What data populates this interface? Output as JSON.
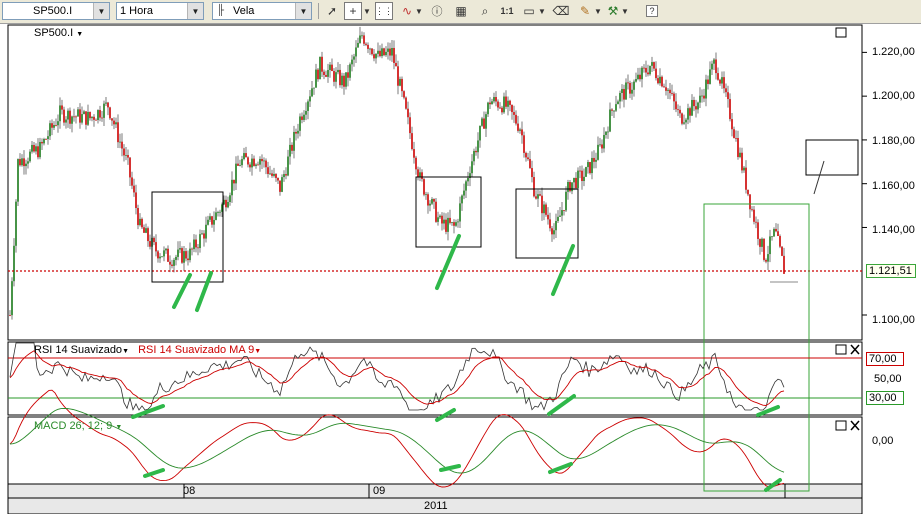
{
  "toolbar": {
    "symbol": "SP500.I",
    "timeframe": "1 Hora",
    "chart_type": "Vela",
    "icons": [
      "cursor-icon",
      "crosshair-icon",
      "dropdown-arrow-icon",
      "grid-dots-icon",
      "indicator-wave-icon",
      "info-icon",
      "chart-options-icon",
      "zoom-icon",
      "one-to-one-icon",
      "rectangle-icon",
      "eraser-icon",
      "paint-icon",
      "tools-icon",
      "help-icon"
    ],
    "one_to_one_label": "1:1",
    "help_label": "?"
  },
  "price_pane": {
    "symbol_label": "SP500.I",
    "price_levels": [
      "1.220,00",
      "1.200,00",
      "1.180,00",
      "1.160,00",
      "1.140,00",
      "1.121,51",
      "1.100,00"
    ],
    "current_price": "1.121,51",
    "colors": {
      "up": "#1a7a1a",
      "down": "#cc0000",
      "current_line": "#cc0000",
      "annotation": "#2fb84a"
    }
  },
  "rsi_pane": {
    "title": "RSI 14 Suavizado",
    "ma_title": "RSI 14 Suavizado MA 9",
    "levels": [
      "70,00",
      "50,00",
      "30,00"
    ]
  },
  "macd_pane": {
    "title": "MACD 26; 12; 9",
    "levels": [
      "0,00"
    ]
  },
  "time_axis": {
    "labels": [
      "08",
      "09"
    ],
    "year": "2011"
  }
}
